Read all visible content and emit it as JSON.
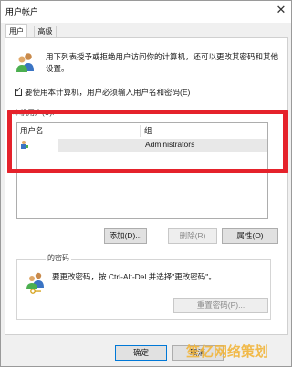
{
  "window": {
    "title": "用户帐户",
    "close_label": "✕"
  },
  "tabs": [
    {
      "label": "用户",
      "active": true
    },
    {
      "label": "高级",
      "active": false
    }
  ],
  "intro": {
    "line1": "用下列表授予或拒绝用户访问你的计算机，还可以更改其密码和其他",
    "line2": "设置。"
  },
  "require_login": {
    "checked": true,
    "label": "要使用本计算机，用户必须输入用户名和密码(E)"
  },
  "users_group": {
    "label": "本机用户(U):",
    "columns": [
      "用户名",
      "组"
    ],
    "rows": [
      {
        "username": "",
        "group": "Administrators"
      }
    ]
  },
  "user_buttons": {
    "add": "添加(D)...",
    "remove": "删除(R)",
    "properties": "属性(O)"
  },
  "password_group": {
    "label": "的密码",
    "text": "要更改密码，按 Ctrl-Alt-Del 并选择\"更改密码\"。",
    "reset_button": "重置密码(P)..."
  },
  "dialog_buttons": {
    "ok": "确定",
    "cancel": "取消"
  },
  "watermark": "笙亿网络策划",
  "colors": {
    "highlight": "#e5222b",
    "accent": "#0078d7",
    "watermark": "#f2b53a"
  }
}
